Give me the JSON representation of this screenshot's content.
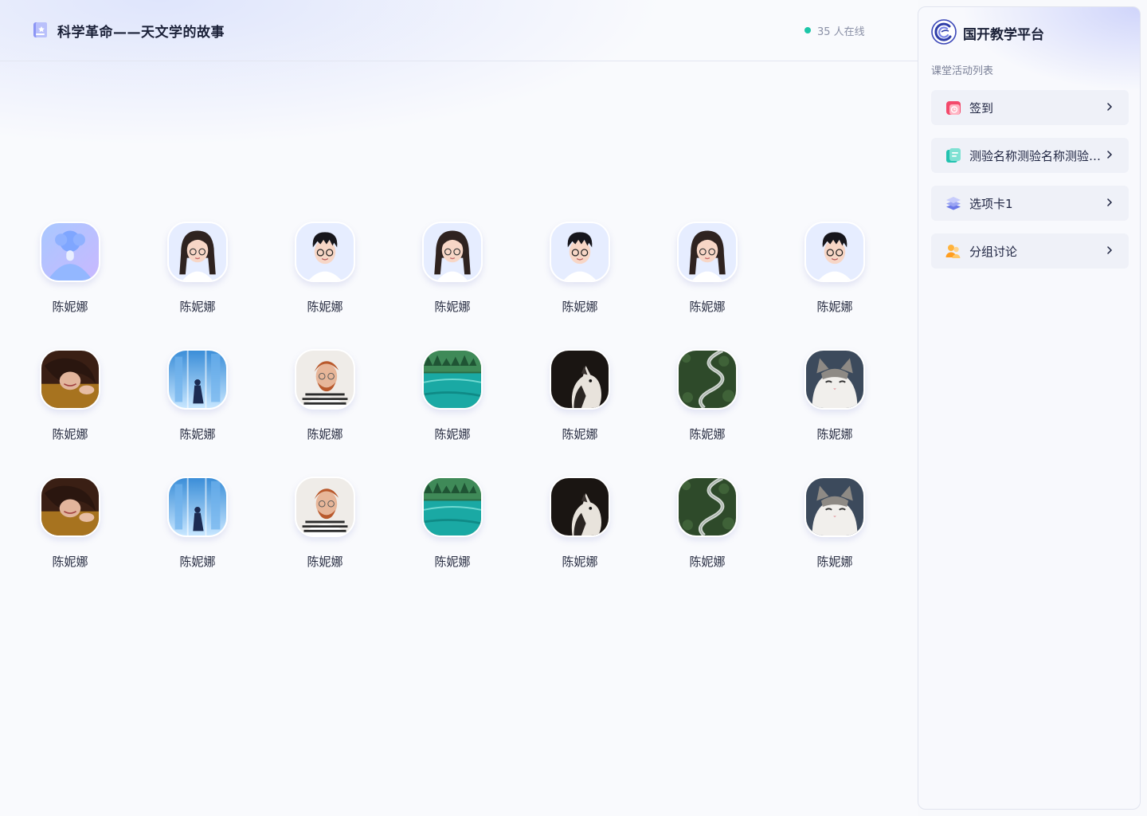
{
  "header": {
    "title": "科学革命——天文学的故事",
    "online_text": "35 人在线",
    "online_color": "#1cc6a8"
  },
  "students": [
    {
      "name": "陈妮娜",
      "avatar": "placeholder-avatar"
    },
    {
      "name": "陈妮娜",
      "avatar": "cartoon-girl-avatar"
    },
    {
      "name": "陈妮娜",
      "avatar": "cartoon-boy-avatar"
    },
    {
      "name": "陈妮娜",
      "avatar": "cartoon-girl-avatar"
    },
    {
      "name": "陈妮娜",
      "avatar": "cartoon-boy-avatar"
    },
    {
      "name": "陈妮娜",
      "avatar": "cartoon-girl-avatar"
    },
    {
      "name": "陈妮娜",
      "avatar": "cartoon-boy-avatar"
    },
    {
      "name": "陈妮娜",
      "avatar": "woman-photo"
    },
    {
      "name": "陈妮娜",
      "avatar": "blue-city-photo"
    },
    {
      "name": "陈妮娜",
      "avatar": "man-photo"
    },
    {
      "name": "陈妮娜",
      "avatar": "lake-photo"
    },
    {
      "name": "陈妮娜",
      "avatar": "black-cat-photo"
    },
    {
      "name": "陈妮娜",
      "avatar": "winding-road-photo"
    },
    {
      "name": "陈妮娜",
      "avatar": "white-cat-photo"
    },
    {
      "name": "陈妮娜",
      "avatar": "woman-photo"
    },
    {
      "name": "陈妮娜",
      "avatar": "blue-city-photo"
    },
    {
      "name": "陈妮娜",
      "avatar": "man-photo"
    },
    {
      "name": "陈妮娜",
      "avatar": "lake-photo"
    },
    {
      "name": "陈妮娜",
      "avatar": "black-cat-photo"
    },
    {
      "name": "陈妮娜",
      "avatar": "winding-road-photo"
    },
    {
      "name": "陈妮娜",
      "avatar": "white-cat-photo"
    }
  ],
  "panel": {
    "brand_name": "国开教学平台",
    "list_title": "课堂活动列表",
    "activities": [
      {
        "label": "签到",
        "icon": "sign-in-icon"
      },
      {
        "label": "测验名称测验名称测验名称",
        "icon": "quiz-icon"
      },
      {
        "label": "选项卡1",
        "icon": "layers-icon"
      },
      {
        "label": "分组讨论",
        "icon": "group-discussion-icon"
      }
    ]
  }
}
